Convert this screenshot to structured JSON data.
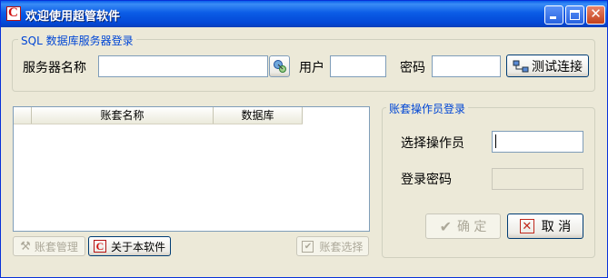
{
  "window": {
    "title": "欢迎使用超管软件",
    "app_icon_glyph": "C",
    "controls": [
      "minimize-icon",
      "maximize-icon",
      "close-icon"
    ]
  },
  "server_login": {
    "legend": "SQL 数据库服务器登录",
    "server_label": "服务器名称",
    "server_value": "",
    "browse_icon": "network-browse-icon",
    "user_label": "用户",
    "user_value": "",
    "password_label": "密码",
    "password_value": "",
    "test_button": "测试连接",
    "test_button_icon": "network-connect-icon"
  },
  "accounts_table": {
    "columns": [
      "",
      "账套名称",
      "数据库"
    ],
    "rows": []
  },
  "operator_login": {
    "legend": "账套操作员登录",
    "operator_label": "选择操作员",
    "operator_value": "",
    "password_label": "登录密码",
    "password_value": ""
  },
  "bottom_buttons": {
    "manage": "账套管理",
    "about": "关于本软件",
    "select": "账套选择",
    "confirm": "确 定",
    "cancel": "取 消"
  },
  "colors": {
    "title_bar": "#0A5FEB",
    "legend_text": "#0046D5",
    "face": "#ECE9D8",
    "cancel_icon": "#C0281C"
  }
}
